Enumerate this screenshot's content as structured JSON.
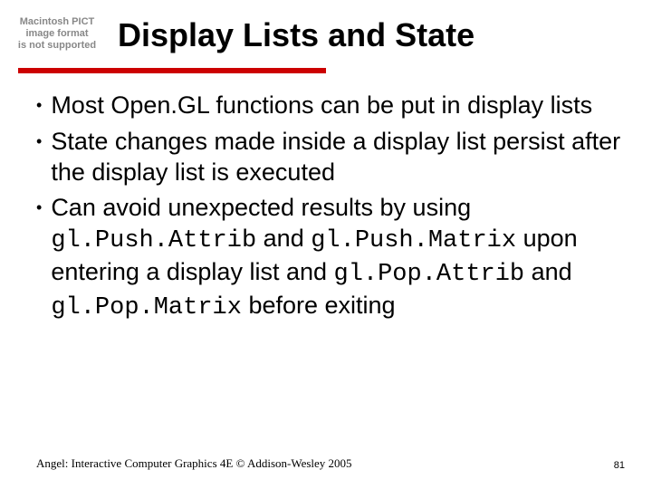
{
  "placeholder": {
    "line1": "Macintosh PICT",
    "line2": "image format",
    "line3": "is not supported"
  },
  "title": "Display Lists and State",
  "bullets": {
    "b1": "Most Open.GL functions can be put in display lists",
    "b2": "State changes made inside a display list persist after the display list is executed",
    "b3_part1": "Can avoid unexpected results by using ",
    "b3_code1": "gl.Push.Attrib",
    "b3_part2": " and ",
    "b3_code2": "gl.Push.Matrix",
    "b3_part3": " upon entering a display list and ",
    "b3_code3": "gl.Pop.Attrib",
    "b3_part4": " and ",
    "b3_code4": "gl.Pop.Matrix",
    "b3_part5": " before exiting"
  },
  "footer": "Angel: Interactive Computer Graphics 4E © Addison-Wesley 2005",
  "pageNumber": "81"
}
